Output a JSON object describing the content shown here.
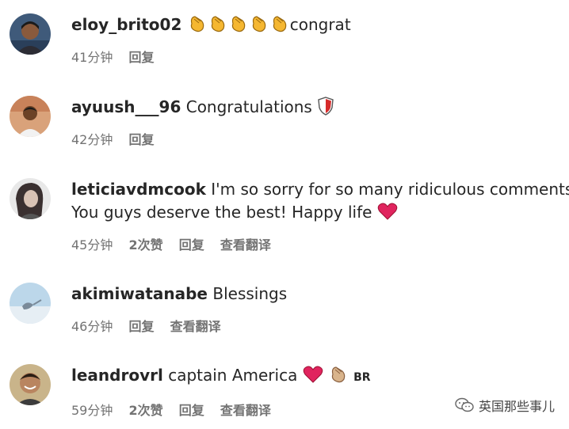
{
  "comments": [
    {
      "username": "eloy_brito02",
      "text": "congrat",
      "emojis": [
        "clap",
        "clap",
        "clap",
        "clap",
        "clap"
      ],
      "time": "41分钟",
      "reply": "回复"
    },
    {
      "username": "ayuush___96",
      "text": " Congratulations ",
      "emojis": [
        "shield"
      ],
      "time": "42分钟",
      "reply": "回复"
    },
    {
      "username": "leticiavdmcook",
      "line1": " I'm so sorry for so many ridiculous comments.",
      "line2": "You guys deserve the best! Happy life ",
      "emojis": [
        "red-heart"
      ],
      "time": "45分钟",
      "likes": "2次赞",
      "reply": "回复",
      "translate": "查看翻译"
    },
    {
      "username": "akimiwatanabe",
      "text": " Blessings",
      "time": "46分钟",
      "reply": "回复",
      "translate": "查看翻译"
    },
    {
      "username": "leandrovrl",
      "text": " captain America ",
      "emojis": [
        "red-heart",
        "clap"
      ],
      "tag": "BR",
      "time": "59分钟",
      "likes": "2次赞",
      "reply": "回复",
      "translate": "查看翻译"
    }
  ],
  "watermark": {
    "text": "英国那些事儿",
    "icon": "wechat-icon"
  },
  "colors": {
    "text": "#262626",
    "meta": "#737373",
    "heart": "#e0245e",
    "clap": "#f5b731"
  }
}
